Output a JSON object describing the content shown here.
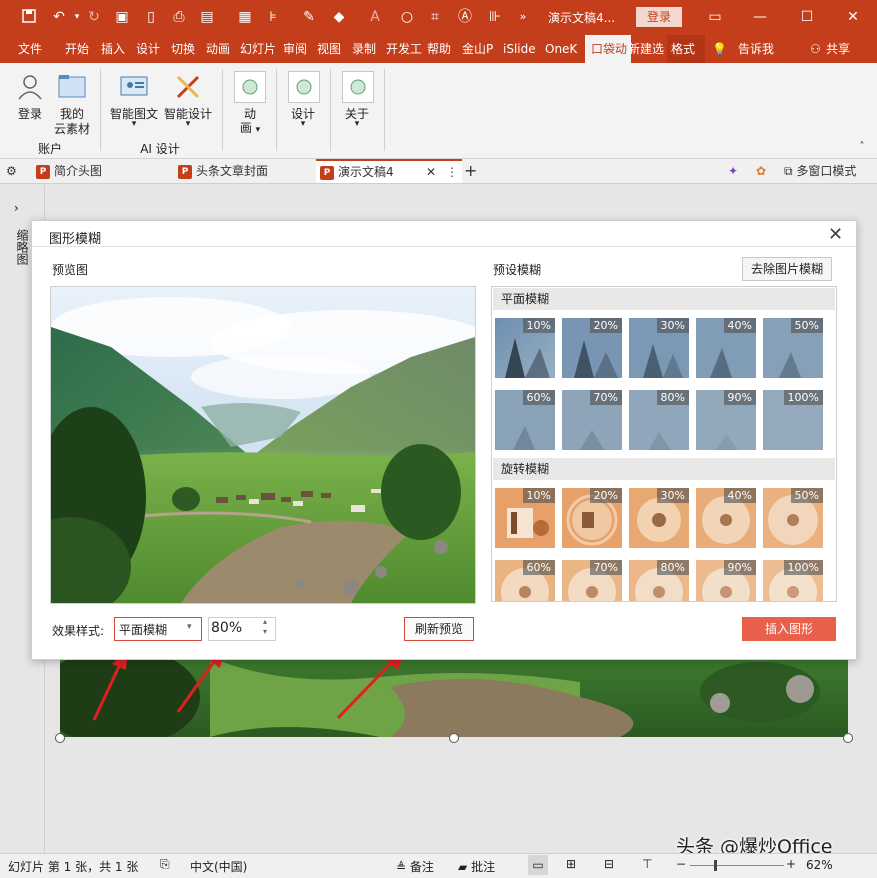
{
  "titlebar": {
    "doc_title": "演示文稿4...",
    "login": "登录"
  },
  "ribbon_tabs": [
    "文件",
    "开始",
    "插入",
    "设计",
    "切换",
    "动画",
    "幻灯片",
    "审阅",
    "视图",
    "录制",
    "开发工",
    "帮助",
    "金山P",
    "iSlide",
    "OneK",
    "口袋动",
    "新建选",
    "格式",
    "告诉我",
    "共享"
  ],
  "ribbon": {
    "account_login": "登录",
    "my_cloud_1": "我的",
    "my_cloud_2": "云素材",
    "group_account": "账户",
    "smart_graphic": "智能图文",
    "smart_design": "智能设计",
    "group_ai": "AI 设计",
    "anim_1": "动",
    "anim_2": "画",
    "design": "设计",
    "about": "关于"
  },
  "doc_tabs": {
    "tab1": "简介头图",
    "tab2": "头条文章封面",
    "tab3": "演示文稿4",
    "multi_window": "多窗口模式"
  },
  "left_panel": {
    "label": "缩略图"
  },
  "dialog": {
    "title": "图形模糊",
    "preview_label": "预览图",
    "preset_label": "预设模糊",
    "remove_button": "去除图片模糊",
    "section_flat": "平面模糊",
    "section_rotate": "旋转模糊",
    "flat_row1": [
      "10%",
      "20%",
      "30%",
      "40%",
      "50%"
    ],
    "flat_row2": [
      "60%",
      "70%",
      "80%",
      "90%",
      "100%"
    ],
    "rot_row1": [
      "10%",
      "20%",
      "30%",
      "40%",
      "50%"
    ],
    "rot_row2": [
      "60%",
      "70%",
      "80%",
      "90%",
      "100%"
    ],
    "effect_label": "效果样式:",
    "effect_value": "平面模糊",
    "percent_value": "80%",
    "refresh_button": "刷新预览",
    "insert_button": "插入图形"
  },
  "statusbar": {
    "slide_info": "幻灯片 第 1 张，共 1 张",
    "language": "中文(中国)",
    "notes": "备注",
    "comments": "批注",
    "zoom": "62%"
  },
  "watermark": "头条 @爆炒Office",
  "colors": {
    "accent": "#c43e1c",
    "insert_button": "#e8604c"
  }
}
